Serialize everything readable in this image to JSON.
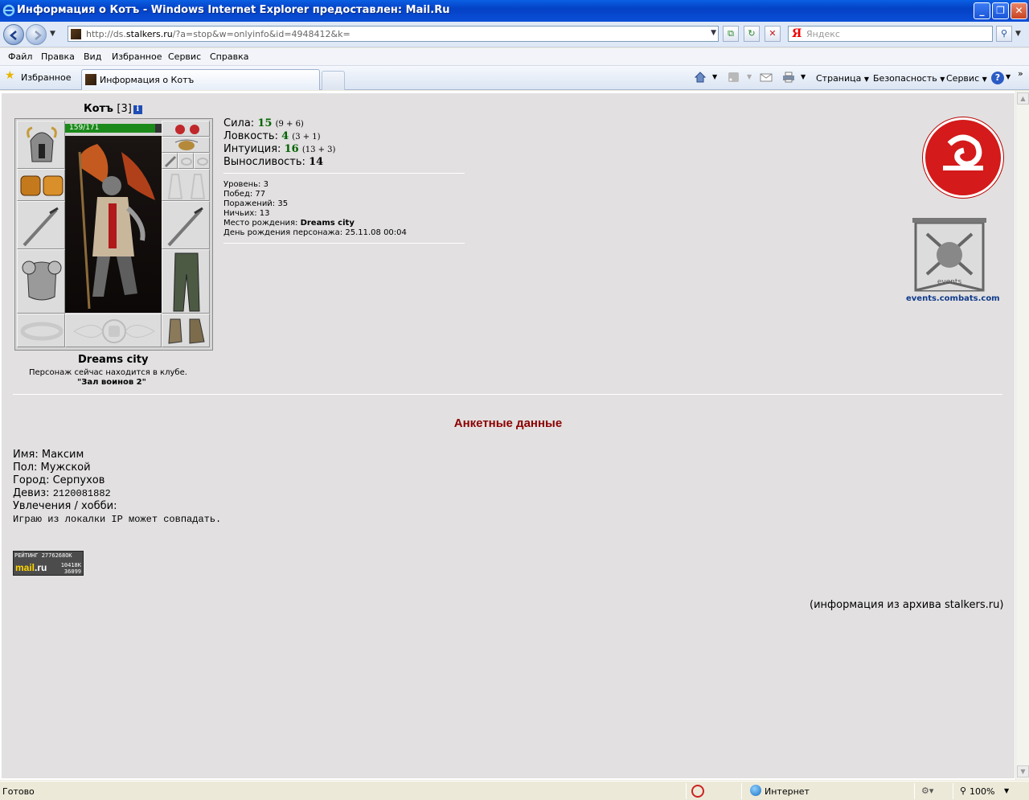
{
  "window": {
    "title": "Информация о Котъ - Windows Internet Explorer предоставлен: Mail.Ru"
  },
  "address": {
    "url_prefix": "http://ds.",
    "url_domain": "stalkers.ru",
    "url_rest": "/?a=stop&w=onlyinfo&id=4948412&k=",
    "search_placeholder": "Яндекс"
  },
  "menu": [
    "Файл",
    "Правка",
    "Вид",
    "Избранное",
    "Сервис",
    "Справка"
  ],
  "tabs": {
    "favorites_label": "Избранное",
    "active_tab": "Информация о Котъ"
  },
  "commandbar": {
    "page": "Страница",
    "safety": "Безопасность",
    "tools": "Сервис"
  },
  "character": {
    "name": "Котъ",
    "level": "[3]",
    "hp_text": "159/171",
    "hp_fraction": 0.93,
    "clan_city": "Dreams city",
    "location_line": "Персонаж сейчас находится в клубе.",
    "location_room": "\"Зал воинов 2\""
  },
  "stats": {
    "strength_label": "Сила:",
    "strength_value": "15",
    "strength_breakdown": "(9 + 6)",
    "agility_label": "Ловкость:",
    "agility_value": "4",
    "agility_breakdown": "(3 + 1)",
    "intuition_label": "Интуиция:",
    "intuition_value": "16",
    "intuition_breakdown": "(13 + 3)",
    "endurance_label": "Выносливость:",
    "endurance_value": "14"
  },
  "meta": {
    "level": "Уровень: 3",
    "wins": "Побед: 77",
    "losses": "Поражений: 35",
    "draws": "Ничьих: 13",
    "birthplace_label": "Место рождения:",
    "birthplace_value": "Dreams city",
    "birthday": "День рождения персонажа: 25.11.08 00:04"
  },
  "right": {
    "events_link": "events.combats.com",
    "events_caption": "events"
  },
  "profile": {
    "heading": "Анкетные данные",
    "name": "Имя: Максим",
    "gender": "Пол: Мужской",
    "city": "Город: Серпухов",
    "motto_label": "Девиз:",
    "motto_value": "2120081882",
    "hobbies_label": "Увлечения / хобби:",
    "hobbies_value": "Играю из локалки IP может совпадать."
  },
  "counter": {
    "rating": "РЕЙТИНГ 2776268OK",
    "brand": "mail",
    "brand_suffix": ".ru",
    "n1": "10418K",
    "n2": "36099"
  },
  "archive_note": "(информация из архива stalkers.ru)",
  "status": {
    "text": "Готово",
    "zone": "Интернет",
    "zoom": "100%"
  }
}
